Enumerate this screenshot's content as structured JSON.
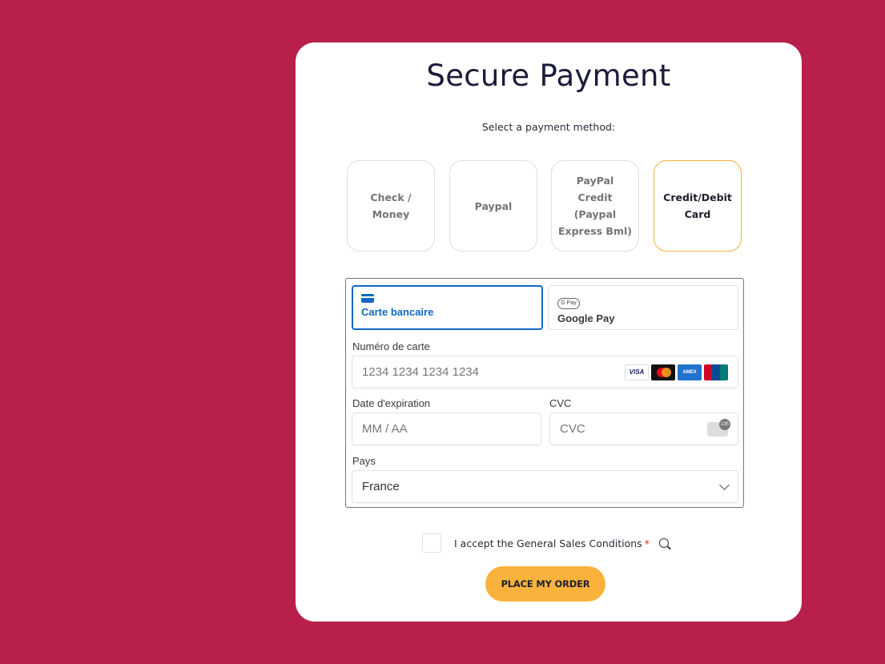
{
  "title": "Secure Payment",
  "subtitle": "Select a payment method:",
  "methods": [
    {
      "label": "Check / Money",
      "selected": false
    },
    {
      "label": "Paypal",
      "selected": false
    },
    {
      "label": "PayPal Credit (Paypal Express Bml)",
      "selected": false
    },
    {
      "label": "Credit/Debit Card",
      "selected": true
    }
  ],
  "payment_form": {
    "tabs": [
      {
        "label": "Carte bancaire",
        "icon": "credit-card-icon",
        "active": true
      },
      {
        "label": "Google Pay",
        "icon": "google-pay-icon",
        "badge": "G Pay",
        "active": false
      }
    ],
    "card_number": {
      "label": "Numéro de carte",
      "placeholder": "1234 1234 1234 1234"
    },
    "brands": [
      "VISA",
      "Mastercard",
      "AMEX",
      "UnionPay"
    ],
    "expiry": {
      "label": "Date d'expiration",
      "placeholder": "MM / AA"
    },
    "cvc": {
      "label": "CVC",
      "placeholder": "CVC"
    },
    "country": {
      "label": "Pays",
      "value": "France"
    }
  },
  "terms": {
    "text": "I accept the General Sales Conditions",
    "required_mark": "*"
  },
  "order_button": "PLACE MY ORDER",
  "colors": {
    "background": "#b81f4b",
    "accent": "#f9b33d",
    "selected_border": "#f3b23b",
    "active_tab": "#0f68c4"
  }
}
